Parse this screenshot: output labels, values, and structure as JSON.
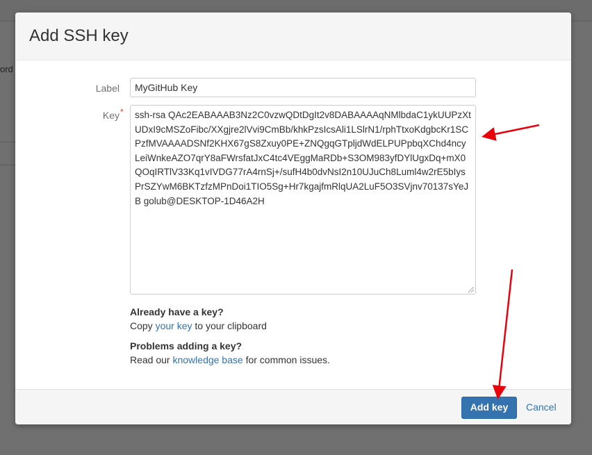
{
  "background": {
    "fragment_text": "ord",
    "overlay_color": "#707070"
  },
  "dialog": {
    "title": "Add SSH key",
    "form": {
      "label_field": {
        "label": "Label",
        "value": "MyGitHub Key"
      },
      "key_field": {
        "label": "Key",
        "required_marker": "*",
        "value": "ssh-rsa QAc2EABAAAB3Nz2C0vzwQDtDgIt2v8DABAAAAqNMlbdaC1ykUUPzXtUDxI9cMSZoFibc/XXgjre2lVvi9CmBb/khkPzsIcsAli1LSlrN1/rphTtxoKdgbcKr1SCPzfMVAAAADSNf2KHX67gS8Zxuy0PE+ZNQgqGTpljdWdELPUPpbqXChd4ncyLeiWnkeAZO7qrY8aFWrsfatJxC4tc4VEggMaRDb+S3OM983yfDYlUgxDq+mX0QOqIRTlV33Kq1vIVDG77rA4rnSj+/sufH4b0dvNsI2n10UJuCh8Luml4w2rE5bIysPrSZYwM6BKTzfzMPnDoi1TIO5Sg+Hr7kgajfmRlqUA2LuF5O3SVjnv70137sYeJB golub@DESKTOP-1D46A2H"
      }
    },
    "help": {
      "already_title": "Already have a key?",
      "copy_prefix": "Copy",
      "copy_link": "your key",
      "copy_suffix": "to your clipboard",
      "problems_title": "Problems adding a key?",
      "read_prefix": "Read our",
      "read_link": "knowledge base",
      "read_suffix": "for common issues."
    },
    "footer": {
      "add_label": "Add key",
      "cancel_label": "Cancel"
    }
  },
  "colors": {
    "primary": "#3572b0",
    "annotation_arrow": "#e8000b",
    "required": "#d04437"
  },
  "annotations": {
    "arrows": [
      "arrow-to-key-field",
      "arrow-to-add-key-button"
    ]
  }
}
